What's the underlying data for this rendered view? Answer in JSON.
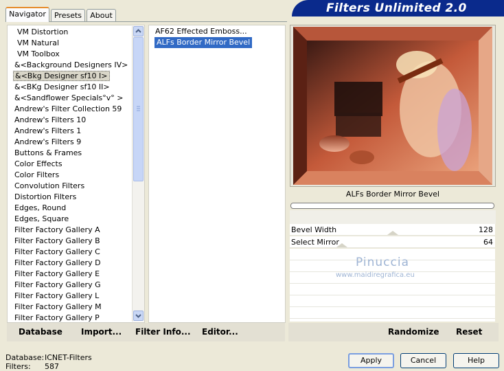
{
  "window": {
    "banner_title": "Filters Unlimited 2.0"
  },
  "tabs": [
    {
      "label": "Navigator",
      "active": true
    },
    {
      "label": "Presets",
      "active": false
    },
    {
      "label": "About",
      "active": false
    }
  ],
  "categories": [
    {
      "label": "VM Distortion",
      "state": "normal",
      "indent": true
    },
    {
      "label": "VM Natural",
      "state": "normal",
      "indent": true
    },
    {
      "label": "VM Toolbox",
      "state": "normal",
      "indent": true
    },
    {
      "label": "&<Background Designers IV>",
      "state": "normal",
      "indent": false
    },
    {
      "label": "&<Bkg Designer sf10 I>",
      "state": "selected",
      "indent": false
    },
    {
      "label": "&<BKg Designer sf10 II>",
      "state": "normal",
      "indent": false
    },
    {
      "label": "&<Sandflower Specials°v° >",
      "state": "normal",
      "indent": false
    },
    {
      "label": "Andrew's Filter Collection 59",
      "state": "normal",
      "indent": false
    },
    {
      "label": "Andrew's Filters 10",
      "state": "normal",
      "indent": false
    },
    {
      "label": "Andrew's Filters 1",
      "state": "normal",
      "indent": false
    },
    {
      "label": "Andrew's Filters 9",
      "state": "normal",
      "indent": false
    },
    {
      "label": "Buttons & Frames",
      "state": "normal",
      "indent": false
    },
    {
      "label": "Color Effects",
      "state": "normal",
      "indent": false
    },
    {
      "label": "Color Filters",
      "state": "normal",
      "indent": false
    },
    {
      "label": "Convolution Filters",
      "state": "normal",
      "indent": false
    },
    {
      "label": "Distortion Filters",
      "state": "normal",
      "indent": false
    },
    {
      "label": "Edges, Round",
      "state": "normal",
      "indent": false
    },
    {
      "label": "Edges, Square",
      "state": "normal",
      "indent": false
    },
    {
      "label": "Filter Factory Gallery A",
      "state": "normal",
      "indent": false
    },
    {
      "label": "Filter Factory Gallery B",
      "state": "normal",
      "indent": false
    },
    {
      "label": "Filter Factory Gallery C",
      "state": "normal",
      "indent": false
    },
    {
      "label": "Filter Factory Gallery D",
      "state": "normal",
      "indent": false
    },
    {
      "label": "Filter Factory Gallery E",
      "state": "normal",
      "indent": false
    },
    {
      "label": "Filter Factory Gallery G",
      "state": "normal",
      "indent": false
    },
    {
      "label": "Filter Factory Gallery L",
      "state": "normal",
      "indent": false
    },
    {
      "label": "Filter Factory Gallery M",
      "state": "normal",
      "indent": false
    },
    {
      "label": "Filter Factory Gallery P",
      "state": "normal",
      "indent": false
    }
  ],
  "filters": [
    {
      "label": "AF62 Effected Emboss...",
      "selected": false
    },
    {
      "label": "ALFs Border Mirror Bevel",
      "selected": true
    }
  ],
  "preview": {
    "caption": "ALFs Border Mirror Bevel",
    "watermark_name": "Pinuccia",
    "watermark_url": "www.maidiregrafica.eu"
  },
  "params": [
    {
      "label": "Bevel Width",
      "value": "128"
    },
    {
      "label": "Select Mirror",
      "value": "64"
    }
  ],
  "toolbar": {
    "database": "Database",
    "import": "Import...",
    "filter_info": "Filter Info...",
    "editor": "Editor...",
    "randomize": "Randomize",
    "reset": "Reset"
  },
  "status": {
    "database_label": "Database:",
    "database_value": "ICNET-Filters",
    "filters_label": "Filters:",
    "filters_value": "587"
  },
  "buttons": {
    "apply": "Apply",
    "cancel": "Cancel",
    "help": "Help"
  },
  "colors": {
    "selection": "#316ac5",
    "banner": "#0a2a8c",
    "window_bg": "#ece9d8"
  }
}
